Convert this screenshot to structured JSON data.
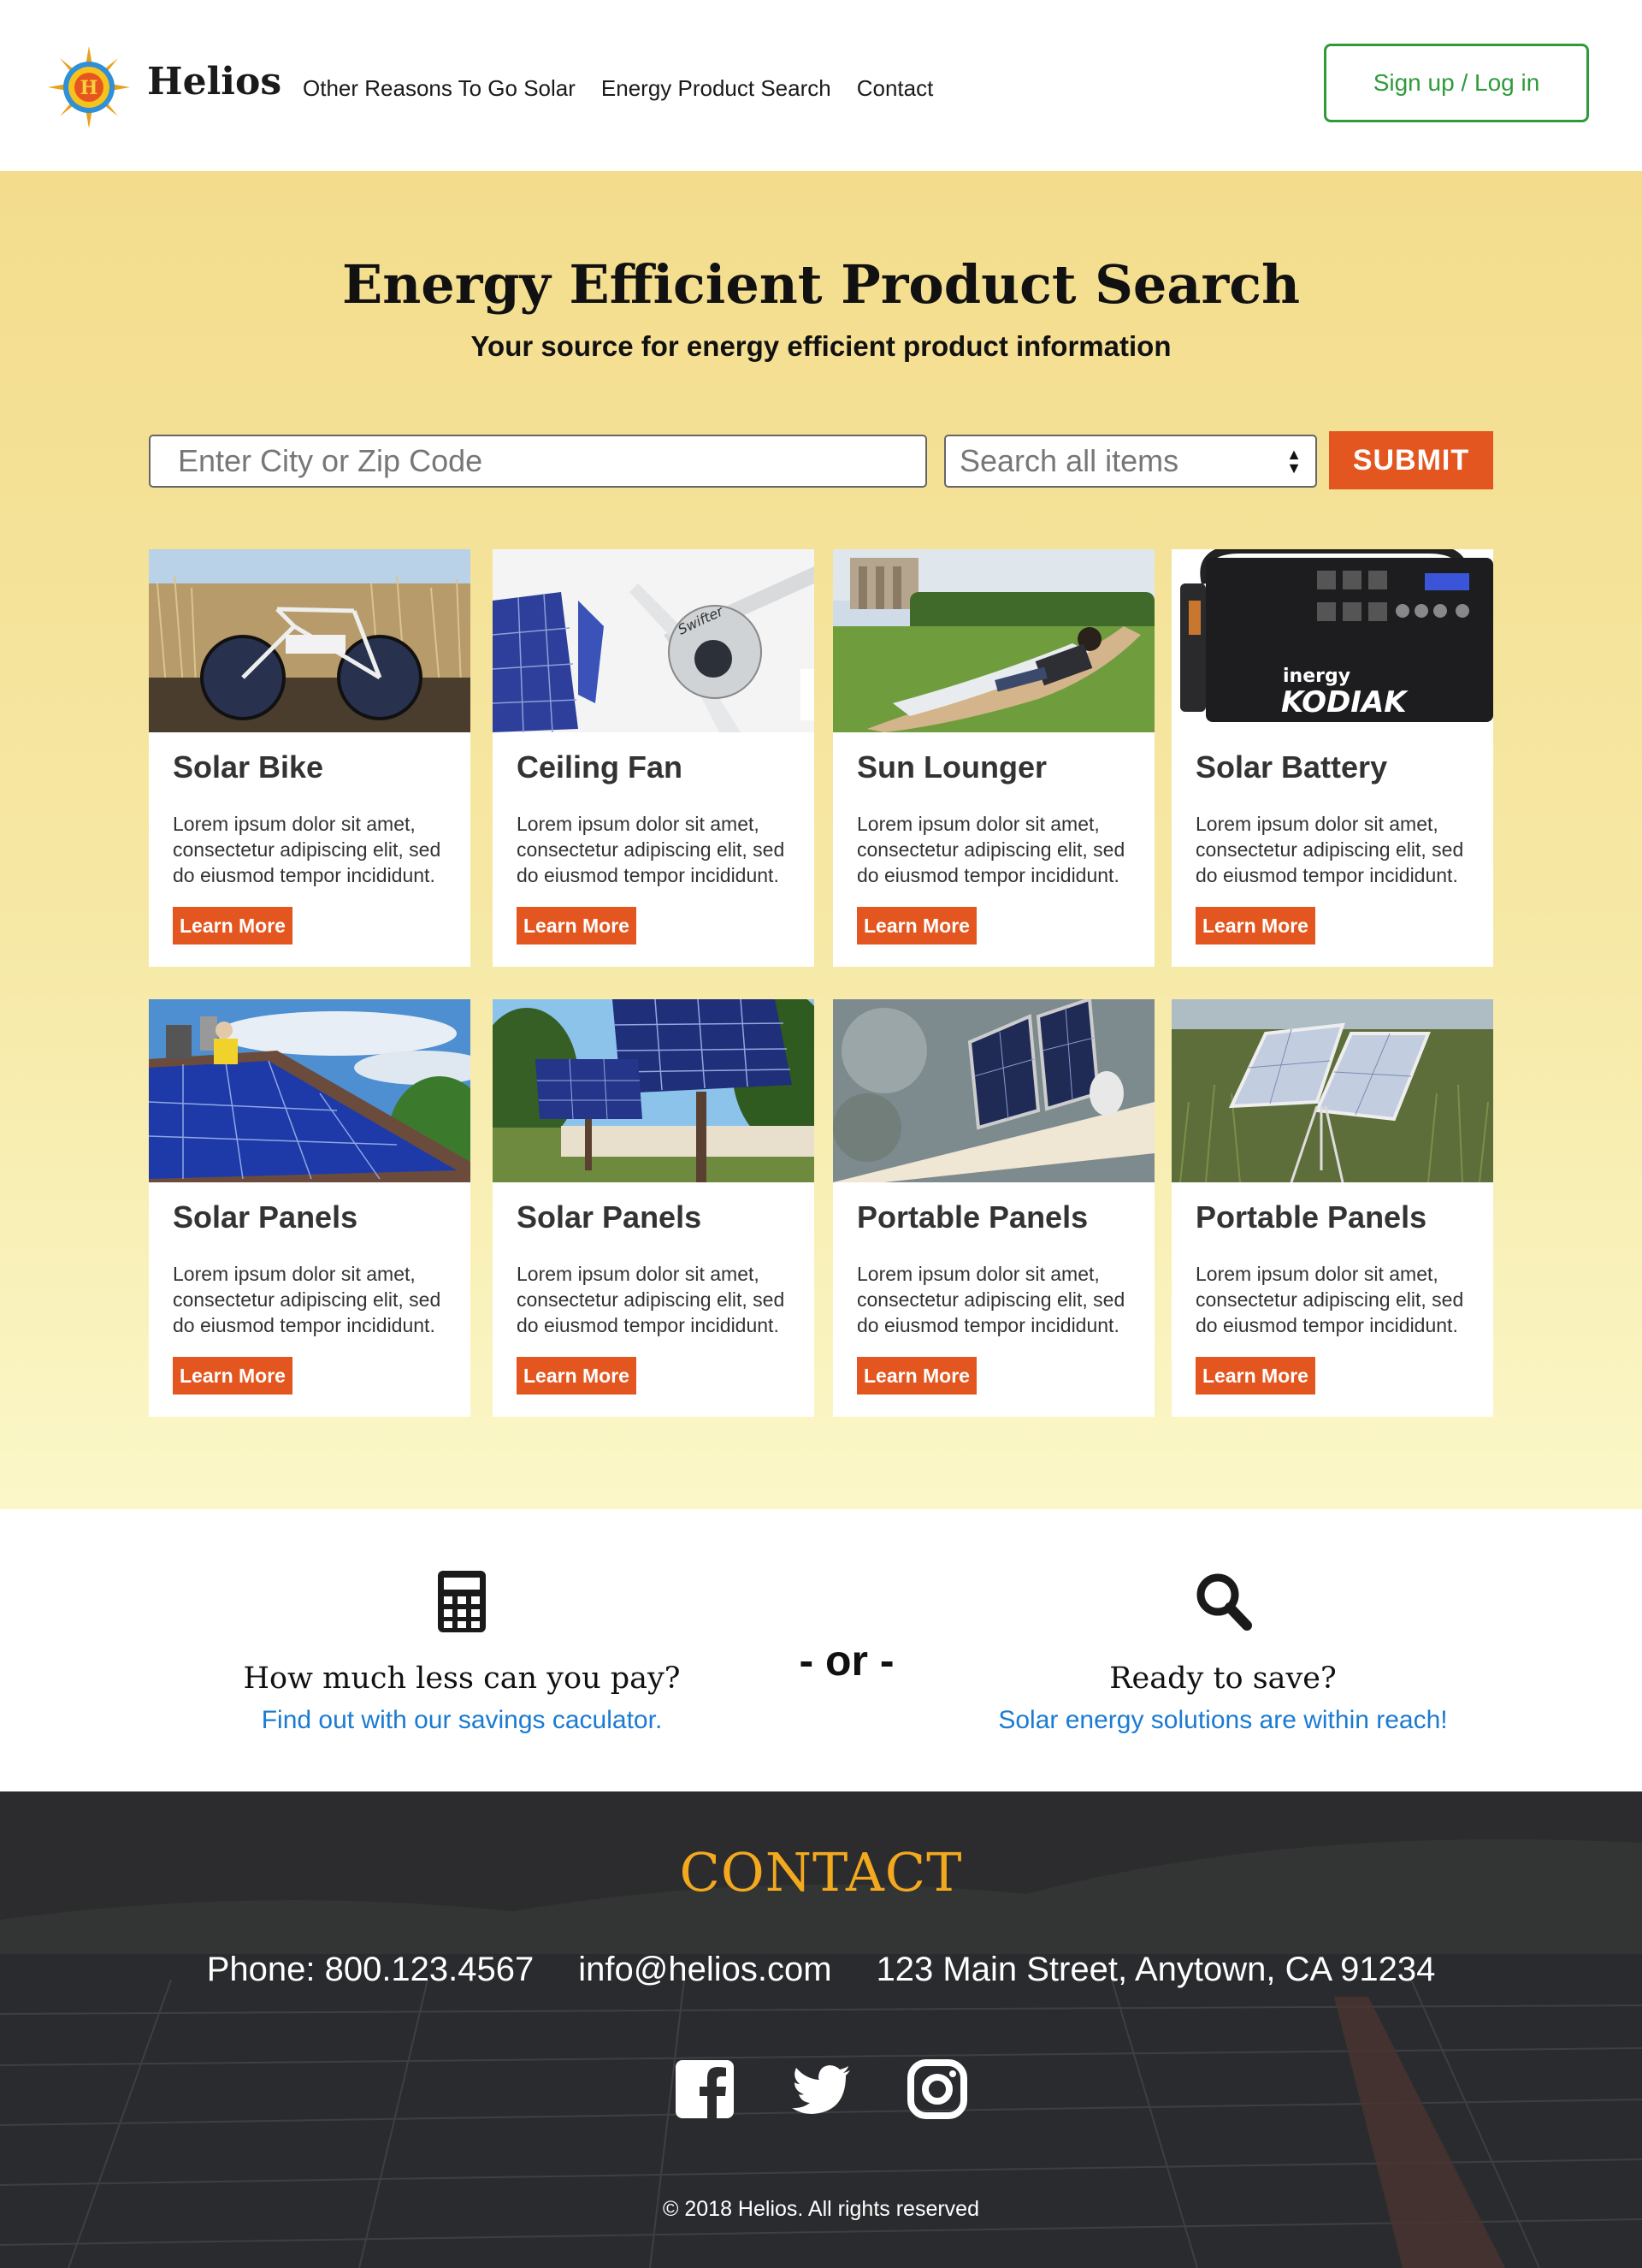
{
  "header": {
    "brand": "Helios",
    "logo_letter": "H",
    "nav": [
      "Other Reasons To Go Solar",
      "Energy Product Search",
      "Contact"
    ],
    "signup_label": "Sign up / Log in"
  },
  "hero": {
    "title": "Energy Efficient Product Search",
    "subtitle": "Your source for energy efficient product information",
    "search_placeholder": "Enter City or Zip Code",
    "select_value": "Search all items",
    "submit_label": "SUBMIT"
  },
  "products": [
    {
      "title": "Solar Bike",
      "desc": "Lorem ipsum dolor sit amet, consectetur adipiscing elit, sed do eiusmod tempor incididunt.",
      "button": "Learn More"
    },
    {
      "title": "Ceiling Fan",
      "desc": "Lorem ipsum dolor sit amet, consectetur adipiscing elit, sed do eiusmod tempor incididunt.",
      "button": "Learn More"
    },
    {
      "title": "Sun Lounger",
      "desc": "Lorem ipsum dolor sit amet, consectetur adipiscing elit, sed do eiusmod tempor incididunt.",
      "button": "Learn More"
    },
    {
      "title": "Solar Battery",
      "desc": "Lorem ipsum dolor sit amet, consectetur adipiscing elit, sed do eiusmod tempor incididunt.",
      "button": "Learn More"
    },
    {
      "title": "Solar Panels",
      "desc": "Lorem ipsum dolor sit amet, consectetur adipiscing elit, sed do eiusmod tempor incididunt.",
      "button": "Learn More"
    },
    {
      "title": "Solar Panels",
      "desc": "Lorem ipsum dolor sit amet, consectetur adipiscing elit, sed do eiusmod tempor incididunt.",
      "button": "Learn More"
    },
    {
      "title": "Portable Panels",
      "desc": "Lorem ipsum dolor sit amet, consectetur adipiscing elit, sed do eiusmod tempor incididunt.",
      "button": "Learn More"
    },
    {
      "title": "Portable Panels",
      "desc": "Lorem ipsum dolor sit amet, consectetur adipiscing elit, sed do eiusmod tempor incididunt.",
      "button": "Learn More"
    }
  ],
  "image_text": {
    "fan_brand": "Swifter",
    "battery_brand": "inergy",
    "battery_model": "KODIAK"
  },
  "middle": {
    "left_question": "How much less can you pay?",
    "left_link": "Find out with our savings caculator.",
    "or_text": "- or -",
    "right_question": "Ready to save?",
    "right_link": "Solar energy solutions are within reach!",
    "left_icon": "calculator-icon",
    "right_icon": "search-icon"
  },
  "footer": {
    "title": "CONTACT",
    "phone": "Phone: 800.123.4567",
    "email": "info@helios.com",
    "address": "123 Main Street, Anytown, CA 91234",
    "social_icons": [
      "facebook-icon",
      "twitter-icon",
      "instagram-icon"
    ],
    "copyright": "© 2018 Helios. All rights reserved"
  },
  "colors": {
    "accent_orange": "#e4561f",
    "signup_green": "#2e9b3a",
    "link_blue": "#1a7bd1",
    "contact_gold": "#f3a91e",
    "hero_yellow": "#f3dc8c"
  }
}
